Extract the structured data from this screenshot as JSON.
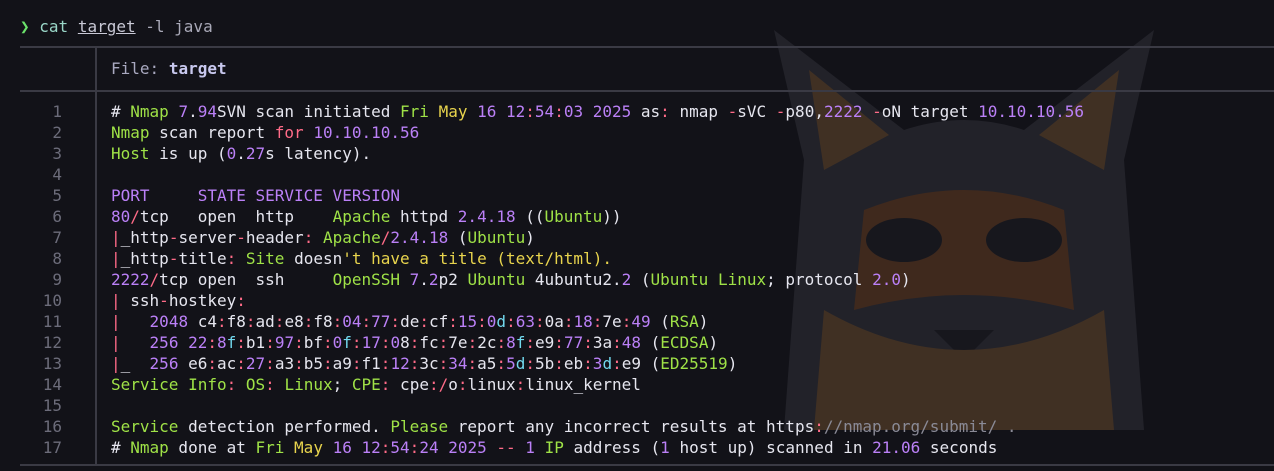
{
  "prompt": {
    "symbol": "❯",
    "command": "cat",
    "file_arg": "target",
    "flags": "-l java"
  },
  "header": {
    "label": "File:",
    "filename": "target"
  },
  "line_numbers": [
    "1",
    "2",
    "3",
    "4",
    "5",
    "6",
    "7",
    "8",
    "9",
    "10",
    "11",
    "12",
    "13",
    "14",
    "15",
    "16",
    "17"
  ],
  "lines": [
    [
      [
        "w",
        "# "
      ],
      [
        "g",
        "Nmap"
      ],
      [
        "w",
        " "
      ],
      [
        "p",
        "7"
      ],
      [
        "w",
        "."
      ],
      [
        "p",
        "94"
      ],
      [
        "w",
        "SVN scan initiated "
      ],
      [
        "g",
        "Fri"
      ],
      [
        "w",
        " "
      ],
      [
        "y",
        "May"
      ],
      [
        "w",
        " "
      ],
      [
        "p",
        "16"
      ],
      [
        "w",
        " "
      ],
      [
        "p",
        "12"
      ],
      [
        "r",
        ":"
      ],
      [
        "p",
        "54"
      ],
      [
        "r",
        ":"
      ],
      [
        "p",
        "03"
      ],
      [
        "w",
        " "
      ],
      [
        "p",
        "2025"
      ],
      [
        "w",
        " as"
      ],
      [
        "r",
        ":"
      ],
      [
        "w",
        " nmap "
      ],
      [
        "r",
        "-"
      ],
      [
        "w",
        "sVC "
      ],
      [
        "r",
        "-"
      ],
      [
        "w",
        "p80,"
      ],
      [
        "p",
        "2222"
      ],
      [
        "w",
        " "
      ],
      [
        "r",
        "-"
      ],
      [
        "w",
        "oN target "
      ],
      [
        "p",
        "10.10.10.56"
      ]
    ],
    [
      [
        "g",
        "Nmap"
      ],
      [
        "w",
        " scan report "
      ],
      [
        "r",
        "for"
      ],
      [
        "w",
        " "
      ],
      [
        "p",
        "10.10.10.56"
      ]
    ],
    [
      [
        "g",
        "Host"
      ],
      [
        "w",
        " is up ("
      ],
      [
        "p",
        "0"
      ],
      [
        "w",
        "."
      ],
      [
        "p",
        "27"
      ],
      [
        "w",
        "s latency)."
      ]
    ],
    [
      [
        "w",
        " "
      ]
    ],
    [
      [
        "p",
        "PORT     STATE SERVICE VERSION"
      ]
    ],
    [
      [
        "p",
        "80"
      ],
      [
        "r",
        "/"
      ],
      [
        "w",
        "tcp   open  http    "
      ],
      [
        "g",
        "Apache"
      ],
      [
        "w",
        " httpd "
      ],
      [
        "p",
        "2.4.18"
      ],
      [
        "w",
        " (("
      ],
      [
        "g",
        "Ubuntu"
      ],
      [
        "w",
        "))"
      ]
    ],
    [
      [
        "r",
        "|"
      ],
      [
        "w",
        "_http"
      ],
      [
        "r",
        "-"
      ],
      [
        "w",
        "server"
      ],
      [
        "r",
        "-"
      ],
      [
        "w",
        "header"
      ],
      [
        "r",
        ":"
      ],
      [
        "w",
        " "
      ],
      [
        "g",
        "Apache"
      ],
      [
        "r",
        "/"
      ],
      [
        "p",
        "2.4.18"
      ],
      [
        "w",
        " ("
      ],
      [
        "g",
        "Ubuntu"
      ],
      [
        "w",
        ")"
      ]
    ],
    [
      [
        "r",
        "|"
      ],
      [
        "w",
        "_http"
      ],
      [
        "r",
        "-"
      ],
      [
        "w",
        "title"
      ],
      [
        "r",
        ":"
      ],
      [
        "w",
        " "
      ],
      [
        "g",
        "Site"
      ],
      [
        "w",
        " doesn"
      ],
      [
        "y",
        "'t have a title (text/html)."
      ]
    ],
    [
      [
        "p",
        "2222"
      ],
      [
        "r",
        "/"
      ],
      [
        "w",
        "tcp open  ssh     "
      ],
      [
        "g",
        "OpenSSH"
      ],
      [
        "w",
        " "
      ],
      [
        "p",
        "7"
      ],
      [
        "w",
        "."
      ],
      [
        "p",
        "2"
      ],
      [
        "w",
        "p2 "
      ],
      [
        "g",
        "Ubuntu"
      ],
      [
        "w",
        " 4ubuntu2."
      ],
      [
        "p",
        "2"
      ],
      [
        "w",
        " ("
      ],
      [
        "g",
        "Ubuntu"
      ],
      [
        "w",
        " "
      ],
      [
        "g",
        "Linux"
      ],
      [
        "w",
        "; protocol "
      ],
      [
        "p",
        "2.0"
      ],
      [
        "w",
        ")"
      ]
    ],
    [
      [
        "r",
        "|"
      ],
      [
        "w",
        " ssh"
      ],
      [
        "r",
        "-"
      ],
      [
        "w",
        "hostkey"
      ],
      [
        "r",
        ":"
      ]
    ],
    [
      [
        "r",
        "|"
      ],
      [
        "w",
        "   "
      ],
      [
        "p",
        "2048"
      ],
      [
        "w",
        " c4"
      ],
      [
        "r",
        ":"
      ],
      [
        "w",
        "f8"
      ],
      [
        "r",
        ":"
      ],
      [
        "w",
        "ad"
      ],
      [
        "r",
        ":"
      ],
      [
        "w",
        "e8"
      ],
      [
        "r",
        ":"
      ],
      [
        "w",
        "f8"
      ],
      [
        "r",
        ":"
      ],
      [
        "p",
        "04"
      ],
      [
        "r",
        ":"
      ],
      [
        "p",
        "77"
      ],
      [
        "r",
        ":"
      ],
      [
        "w",
        "de"
      ],
      [
        "r",
        ":"
      ],
      [
        "w",
        "cf"
      ],
      [
        "r",
        ":"
      ],
      [
        "p",
        "15"
      ],
      [
        "r",
        ":"
      ],
      [
        "p",
        "0"
      ],
      [
        "c",
        "d"
      ],
      [
        "r",
        ":"
      ],
      [
        "p",
        "63"
      ],
      [
        "r",
        ":"
      ],
      [
        "w",
        "0a"
      ],
      [
        "r",
        ":"
      ],
      [
        "p",
        "18"
      ],
      [
        "r",
        ":"
      ],
      [
        "w",
        "7e"
      ],
      [
        "r",
        ":"
      ],
      [
        "p",
        "49"
      ],
      [
        "w",
        " ("
      ],
      [
        "g",
        "RSA"
      ],
      [
        "w",
        ")"
      ]
    ],
    [
      [
        "r",
        "|"
      ],
      [
        "w",
        "   "
      ],
      [
        "p",
        "256"
      ],
      [
        "w",
        " "
      ],
      [
        "p",
        "22"
      ],
      [
        "r",
        ":"
      ],
      [
        "p",
        "8"
      ],
      [
        "c",
        "f"
      ],
      [
        "r",
        ":"
      ],
      [
        "w",
        "b1"
      ],
      [
        "r",
        ":"
      ],
      [
        "p",
        "97"
      ],
      [
        "r",
        ":"
      ],
      [
        "w",
        "bf"
      ],
      [
        "r",
        ":"
      ],
      [
        "p",
        "0"
      ],
      [
        "c",
        "f"
      ],
      [
        "r",
        ":"
      ],
      [
        "p",
        "17"
      ],
      [
        "r",
        ":"
      ],
      [
        "p",
        "0"
      ],
      [
        "w",
        "8"
      ],
      [
        "r",
        ":"
      ],
      [
        "w",
        "fc"
      ],
      [
        "r",
        ":"
      ],
      [
        "w",
        "7e"
      ],
      [
        "r",
        ":"
      ],
      [
        "w",
        "2c"
      ],
      [
        "r",
        ":"
      ],
      [
        "p",
        "8"
      ],
      [
        "c",
        "f"
      ],
      [
        "r",
        ":"
      ],
      [
        "w",
        "e9"
      ],
      [
        "r",
        ":"
      ],
      [
        "p",
        "77"
      ],
      [
        "r",
        ":"
      ],
      [
        "w",
        "3a"
      ],
      [
        "r",
        ":"
      ],
      [
        "p",
        "48"
      ],
      [
        "w",
        " ("
      ],
      [
        "g",
        "ECDSA"
      ],
      [
        "w",
        ")"
      ]
    ],
    [
      [
        "r",
        "|"
      ],
      [
        "w",
        "_  "
      ],
      [
        "p",
        "256"
      ],
      [
        "w",
        " e6"
      ],
      [
        "r",
        ":"
      ],
      [
        "w",
        "ac"
      ],
      [
        "r",
        ":"
      ],
      [
        "p",
        "27"
      ],
      [
        "r",
        ":"
      ],
      [
        "w",
        "a3"
      ],
      [
        "r",
        ":"
      ],
      [
        "w",
        "b5"
      ],
      [
        "r",
        ":"
      ],
      [
        "w",
        "a9"
      ],
      [
        "r",
        ":"
      ],
      [
        "w",
        "f1"
      ],
      [
        "r",
        ":"
      ],
      [
        "p",
        "12"
      ],
      [
        "r",
        ":"
      ],
      [
        "w",
        "3c"
      ],
      [
        "r",
        ":"
      ],
      [
        "p",
        "34"
      ],
      [
        "r",
        ":"
      ],
      [
        "w",
        "a5"
      ],
      [
        "r",
        ":"
      ],
      [
        "p",
        "5"
      ],
      [
        "c",
        "d"
      ],
      [
        "r",
        ":"
      ],
      [
        "w",
        "5b"
      ],
      [
        "r",
        ":"
      ],
      [
        "w",
        "eb"
      ],
      [
        "r",
        ":"
      ],
      [
        "p",
        "3"
      ],
      [
        "c",
        "d"
      ],
      [
        "r",
        ":"
      ],
      [
        "w",
        "e9"
      ],
      [
        "w",
        " ("
      ],
      [
        "g",
        "ED25519"
      ],
      [
        "w",
        ")"
      ]
    ],
    [
      [
        "g",
        "Service"
      ],
      [
        "w",
        " "
      ],
      [
        "g",
        "Info"
      ],
      [
        "r",
        ":"
      ],
      [
        "w",
        " "
      ],
      [
        "g",
        "OS"
      ],
      [
        "r",
        ":"
      ],
      [
        "w",
        " "
      ],
      [
        "g",
        "Linux"
      ],
      [
        "w",
        "; "
      ],
      [
        "g",
        "CPE"
      ],
      [
        "r",
        ":"
      ],
      [
        "w",
        " cpe"
      ],
      [
        "r",
        ":/"
      ],
      [
        "w",
        "o"
      ],
      [
        "r",
        ":"
      ],
      [
        "w",
        "linux"
      ],
      [
        "r",
        ":"
      ],
      [
        "w",
        "linux_kernel"
      ]
    ],
    [
      [
        "w",
        " "
      ]
    ],
    [
      [
        "g",
        "Service"
      ],
      [
        "w",
        " detection performed. "
      ],
      [
        "g",
        "Please"
      ],
      [
        "w",
        " report any incorrect results at https"
      ],
      [
        "r",
        ":"
      ],
      [
        "m",
        "//nmap.org/submit/ ."
      ]
    ],
    [
      [
        "w",
        "# "
      ],
      [
        "g",
        "Nmap"
      ],
      [
        "w",
        " done at "
      ],
      [
        "g",
        "Fri"
      ],
      [
        "w",
        " "
      ],
      [
        "y",
        "May"
      ],
      [
        "w",
        " "
      ],
      [
        "p",
        "16"
      ],
      [
        "w",
        " "
      ],
      [
        "p",
        "12"
      ],
      [
        "r",
        ":"
      ],
      [
        "p",
        "54"
      ],
      [
        "r",
        ":"
      ],
      [
        "p",
        "24"
      ],
      [
        "w",
        " "
      ],
      [
        "p",
        "2025"
      ],
      [
        "w",
        " "
      ],
      [
        "r",
        "--"
      ],
      [
        "w",
        " "
      ],
      [
        "p",
        "1"
      ],
      [
        "w",
        " "
      ],
      [
        "g",
        "IP"
      ],
      [
        "w",
        " address ("
      ],
      [
        "p",
        "1"
      ],
      [
        "w",
        " host up) scanned in "
      ],
      [
        "p",
        "21.06"
      ],
      [
        "w",
        " seconds"
      ]
    ]
  ],
  "colors": {
    "background": "#121218",
    "green": "#9fe247",
    "purple": "#bb80f7",
    "yellow": "#e8d44d",
    "red": "#ff6b88",
    "cyan": "#72d9ee",
    "rule": "#3a3a44"
  },
  "icons": {
    "prompt": "chevron-right-icon",
    "background": "cat-wallpaper"
  }
}
